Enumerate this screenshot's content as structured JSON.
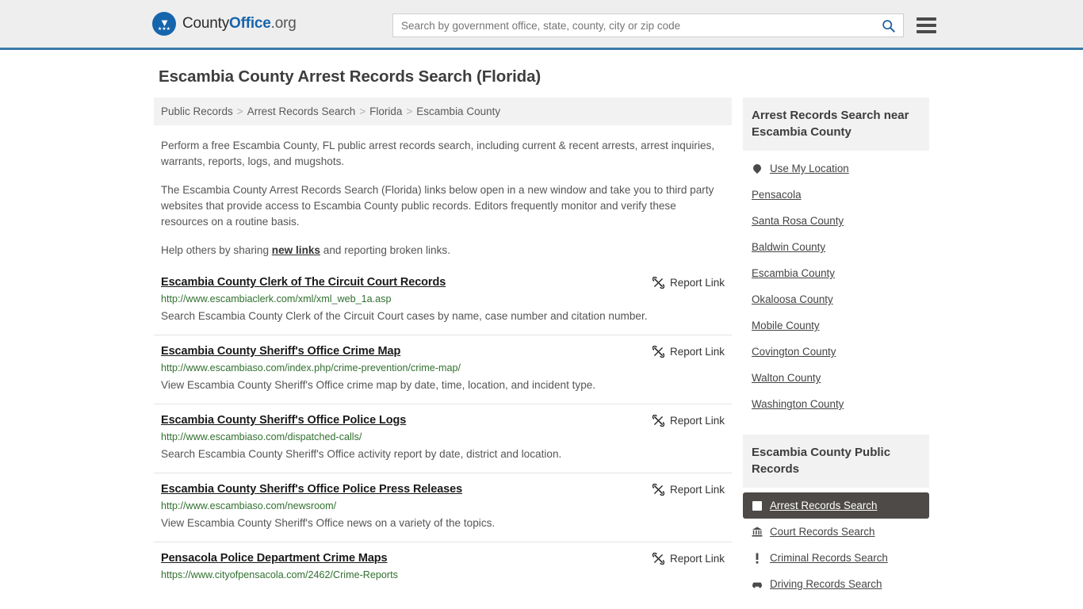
{
  "header": {
    "logo": {
      "name_part1": "County",
      "name_part2": "Office",
      "name_part3": ".org",
      "eagle_icon": "eagle-icon",
      "stars": "★★★"
    },
    "search": {
      "placeholder": "Search by government office, state, county, city or zip code",
      "value": "",
      "search_icon": "search-icon"
    },
    "menu_icon": "hamburger-menu-icon"
  },
  "page_title": "Escambia County Arrest Records Search (Florida)",
  "breadcrumb": {
    "separator": ">",
    "items": [
      {
        "label": "Public Records"
      },
      {
        "label": "Arrest Records Search"
      },
      {
        "label": "Florida"
      },
      {
        "label": "Escambia County"
      }
    ]
  },
  "intro": {
    "paragraph1": "Perform a free Escambia County, FL public arrest records search, including current & recent arrests, arrest inquiries, warrants, reports, logs, and mugshots.",
    "paragraph2": "The Escambia County Arrest Records Search (Florida) links below open in a new window and take you to third party websites that provide access to Escambia County public records. Editors frequently monitor and verify these resources on a routine basis.",
    "paragraph3_before": "Help others by sharing ",
    "paragraph3_link": "new links",
    "paragraph3_after": " and reporting broken links."
  },
  "report_link_label": "Report Link",
  "report_link_icon": "broken-link-icon",
  "results": [
    {
      "title": "Escambia County Clerk of The Circuit Court Records",
      "url": "http://www.escambiaclerk.com/xml/xml_web_1a.asp",
      "description": "Search Escambia County Clerk of the Circuit Court cases by name, case number and citation number."
    },
    {
      "title": "Escambia County Sheriff's Office Crime Map",
      "url": "http://www.escambiaso.com/index.php/crime-prevention/crime-map/",
      "description": "View Escambia County Sheriff's Office crime map by date, time, location, and incident type."
    },
    {
      "title": "Escambia County Sheriff's Office Police Logs",
      "url": "http://www.escambiaso.com/dispatched-calls/",
      "description": "Search Escambia County Sheriff's Office activity report by date, district and location."
    },
    {
      "title": "Escambia County Sheriff's Office Police Press Releases",
      "url": "http://www.escambiaso.com/newsroom/",
      "description": "View Escambia County Sheriff's Office news on a variety of the topics."
    },
    {
      "title": "Pensacola Police Department Crime Maps",
      "url": "https://www.cityofpensacola.com/2462/Crime-Reports",
      "description": ""
    }
  ],
  "sidebar": {
    "nearby": {
      "heading": "Arrest Records Search near Escambia County",
      "items": [
        {
          "label": "Use My Location",
          "icon": "map-pin-icon"
        },
        {
          "label": "Pensacola",
          "icon": ""
        },
        {
          "label": "Santa Rosa County",
          "icon": ""
        },
        {
          "label": "Baldwin County",
          "icon": ""
        },
        {
          "label": "Escambia County",
          "icon": ""
        },
        {
          "label": "Okaloosa County",
          "icon": ""
        },
        {
          "label": "Mobile County",
          "icon": ""
        },
        {
          "label": "Covington County",
          "icon": ""
        },
        {
          "label": "Walton County",
          "icon": ""
        },
        {
          "label": "Washington County",
          "icon": ""
        }
      ]
    },
    "public_records": {
      "heading": "Escambia County Public Records",
      "items": [
        {
          "label": "Arrest Records Search",
          "icon": "fingerprint-card-icon",
          "active": true
        },
        {
          "label": "Court Records Search",
          "icon": "courthouse-icon",
          "active": false
        },
        {
          "label": "Criminal Records Search",
          "icon": "exclamation-icon",
          "active": false
        },
        {
          "label": "Driving Records Search",
          "icon": "car-icon",
          "active": false
        }
      ]
    }
  },
  "colors": {
    "header_bg": "#eeeeee",
    "header_border": "#3b7aa8",
    "brand_blue": "#1565ad",
    "url_green": "#31702f",
    "active_item_bg": "#4d4a47",
    "panel_gray": "#f2f2f2"
  }
}
